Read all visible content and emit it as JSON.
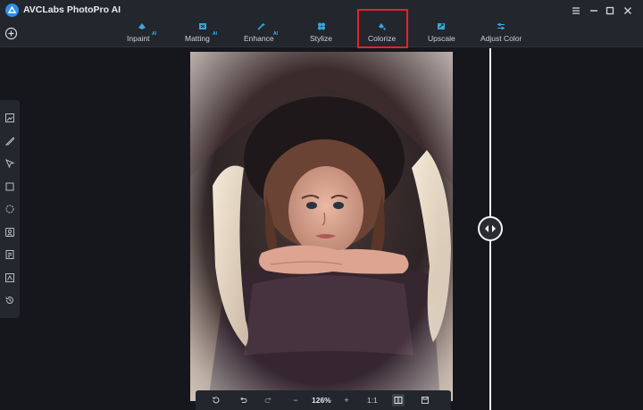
{
  "app": {
    "title": "AVCLabs PhotoPro AI"
  },
  "toolbar": {
    "tools": [
      {
        "label": "Inpaint",
        "ai": "AI"
      },
      {
        "label": "Matting",
        "ai": "AI"
      },
      {
        "label": "Enhance",
        "ai": "AI"
      },
      {
        "label": "Stylize",
        "ai": ""
      },
      {
        "label": "Colorize",
        "ai": ""
      },
      {
        "label": "Upscale",
        "ai": ""
      },
      {
        "label": "Adjust Color",
        "ai": ""
      }
    ],
    "active_tool": "Colorize"
  },
  "bottombar": {
    "zoom": "126%",
    "ratio": "1:1",
    "minus": "−",
    "plus": "+"
  },
  "colors": {
    "accent": "#2fb8ff",
    "highlight": "#e0242a",
    "background": "#15171c",
    "panel": "#23262d"
  },
  "icons": {
    "sidebar": [
      "image-icon",
      "brush-icon",
      "pointer-icon",
      "rectangle-select-icon",
      "lasso-icon",
      "portrait-icon",
      "layers-icon",
      "stamp-icon",
      "history-icon"
    ]
  }
}
